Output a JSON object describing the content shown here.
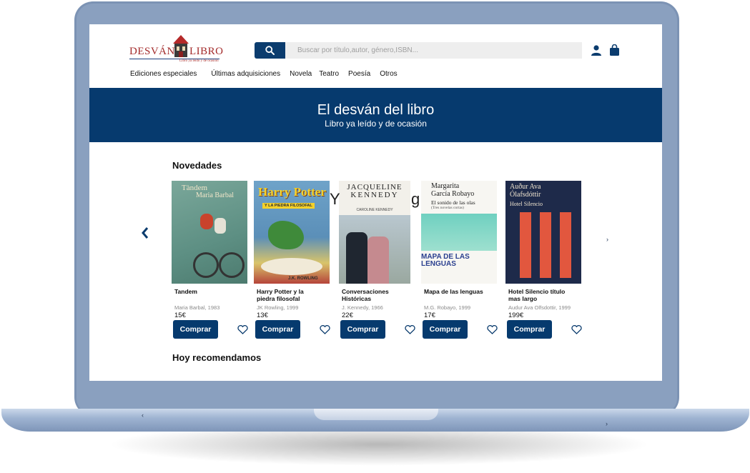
{
  "header": {
    "logo_left": "DESVÁN",
    "logo_right": "LIBRO",
    "logo_tagline": "Libro ya leído y de ocasión",
    "search_placeholder": "Buscar por título,autor, género,ISBN..."
  },
  "nav": [
    "Ediciones especiales",
    "Últimas adquisiciones",
    "Novela",
    "Teatro",
    "Poesía",
    "Otros"
  ],
  "banner": {
    "title": "El desván del libro",
    "subtitle": "Libro ya leído y de ocasión"
  },
  "sections": {
    "new": "Novedades",
    "recommended": "Hoy recomendamos"
  },
  "stray_letters": [
    "Y",
    "g"
  ],
  "books": [
    {
      "title": "Tandem",
      "author": "Maria Barbal, 1983",
      "price": "15€",
      "button": "Comprar",
      "cover_text": [
        "Tàndem",
        "Maria Barbal"
      ]
    },
    {
      "title": "Harry Potter y la piedra filosofal",
      "author": "JK Rowling, 1999",
      "price": "13€",
      "button": "Comprar",
      "cover_text": [
        "Harry Potter",
        "Y LA PIEDRA FILOSOFAL",
        "J.K. ROWLING"
      ]
    },
    {
      "title": "Conversaciones Históricas",
      "author": "J. Kennedy, 1966",
      "price": "22€",
      "button": "Comprar",
      "cover_text": [
        "JACQUELINE",
        "KENNEDY",
        "CAROLINE KENNEDY"
      ]
    },
    {
      "title": "Mapa de las lenguas",
      "author": "M.G. Robayo, 1999",
      "price": "17€",
      "button": "Comprar",
      "cover_text": [
        "Margarita",
        "García Robayo",
        "El sonido de las olas",
        "(Tres novelas cortas)",
        "MAPA DE LAS",
        "LENGUAS"
      ]
    },
    {
      "title": "Hotel Silencio título mas largo",
      "author": "Audur Ava Olfsdottir, 1999",
      "price": "199€",
      "button": "Comprar",
      "cover_text": [
        "Auður Ava",
        "Ólafsdóttir",
        "Hotel Silencio"
      ]
    }
  ],
  "colors": {
    "brand_navy": "#063a6e",
    "logo_red": "#a32a2a",
    "laptop_frame": "#8aa0bf"
  },
  "icons": [
    "search-icon",
    "user-icon",
    "shopping-bag-icon",
    "chevron-left-icon",
    "chevron-right-icon",
    "heart-icon"
  ]
}
